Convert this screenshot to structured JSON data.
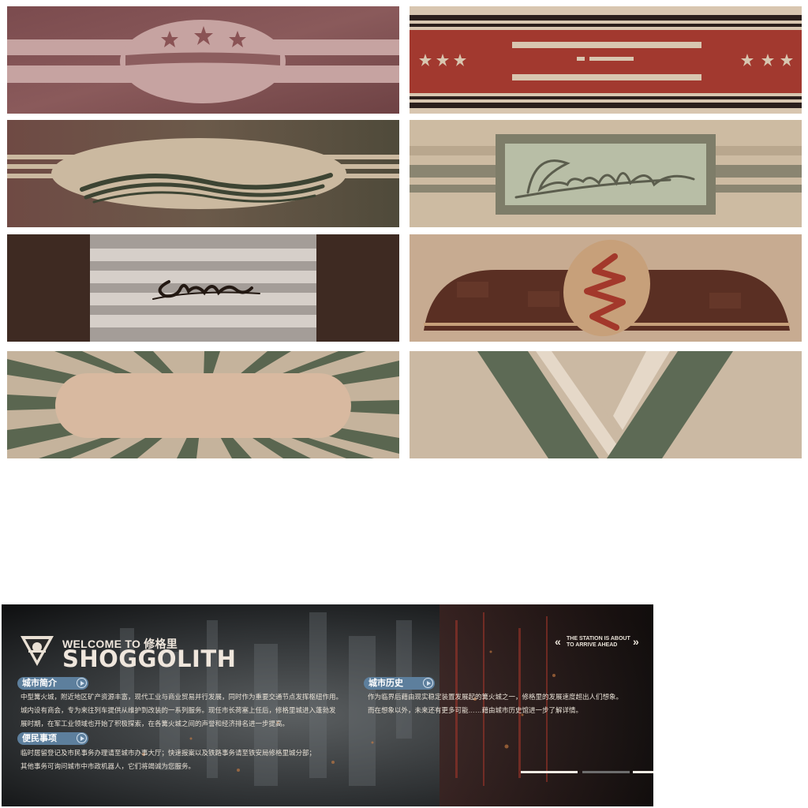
{
  "tiles": [
    {
      "name": "tile-stars-oval",
      "icon": "three-stars"
    },
    {
      "name": "tile-red-stars-stripes",
      "icon": "three-stars-both-sides"
    },
    {
      "name": "tile-wave-oval",
      "icon": "waves"
    },
    {
      "name": "tile-signature-frame",
      "icon": "signature"
    },
    {
      "name": "tile-signature-stripes",
      "icon": "signature"
    },
    {
      "name": "tile-arch-croissant",
      "icon": "croissant"
    },
    {
      "name": "tile-sunburst-capsule",
      "icon": "sunburst"
    },
    {
      "name": "tile-v-chevron",
      "icon": "v-shape"
    }
  ],
  "banner": {
    "welcome": "WELCOME TO",
    "city_cn": "修格里",
    "city_title": "SHOGGOLITH",
    "logo_text": "SHOGGOLITH",
    "arrive_line1": "THE STATION IS ABOUT",
    "arrive_line2": "TO ARRIVE AHEAD",
    "sections": {
      "intro": {
        "label": "城市简介",
        "lines": [
          "中型篝火城，附近地区矿产资源丰富，现代工业与商业贸易并行发展，同时作为重要交通节点发挥枢纽作用。",
          "城内设有商会，专为来往列车提供从维护到改装的一系列服务。现任市长荷塞上任后，修格里城进入蓬勃发",
          "展时期，在军工业领域也开始了积极探索，在各篝火城之间的声誉和经济排名进一步提高。"
        ]
      },
      "services": {
        "label": "便民事项",
        "lines": [
          "临时居留登记及市民事务办理请至城市办事大厅；快速报案以及铁路事务请至铁安局修格里城分部；",
          "其他事务可询问城市中市政机器人，它们将竭诚为您服务。"
        ]
      },
      "history": {
        "label": "城市历史",
        "lines": [
          "作为临界后藉由现实稳定装置发展起的篝火城之一，修格里的发展速度超出人们想象。",
          "而在想象以外，未来还有更多可能……藉由城市历史馆进一步了解详情。"
        ]
      }
    },
    "colors": {
      "tag": "#5d7f9d",
      "text": "#e8e1d6",
      "title": "#efe6dc"
    }
  }
}
